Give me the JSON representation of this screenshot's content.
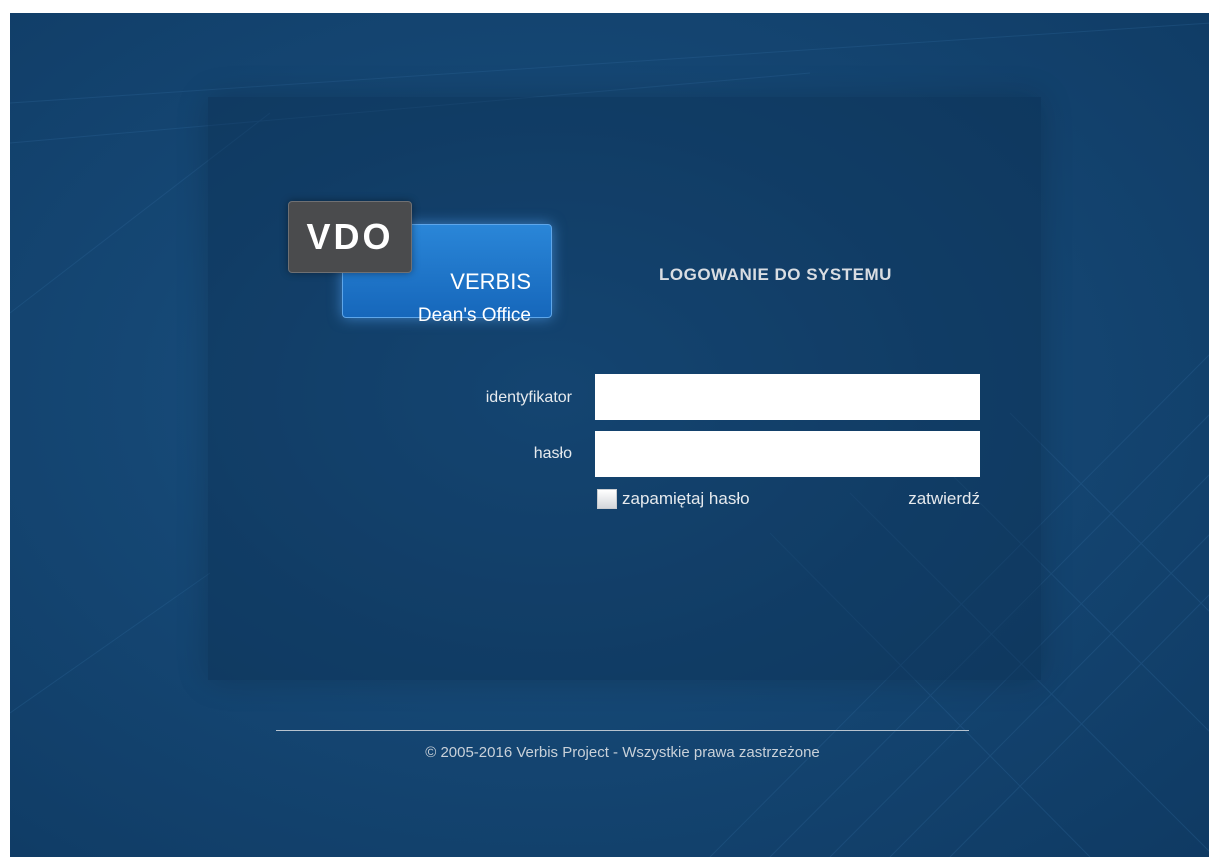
{
  "logo": {
    "mark": "VDO",
    "line1": "VERBIS",
    "line2": "Dean's Office"
  },
  "login": {
    "title": "LOGOWANIE DO SYSTEMU",
    "id_label": "identyfikator",
    "id_value": "",
    "password_label": "hasło",
    "password_value": "",
    "remember_label": "zapamiętaj hasło",
    "remember_checked": false,
    "submit_label": "zatwierdź"
  },
  "footer": {
    "copyright": "© 2005-2016 Verbis Project - Wszystkie prawa zastrzeżone"
  },
  "colors": {
    "background": "#154774",
    "logo_blue": "#1a6fc4",
    "logo_dark": "#4a4b4d"
  }
}
